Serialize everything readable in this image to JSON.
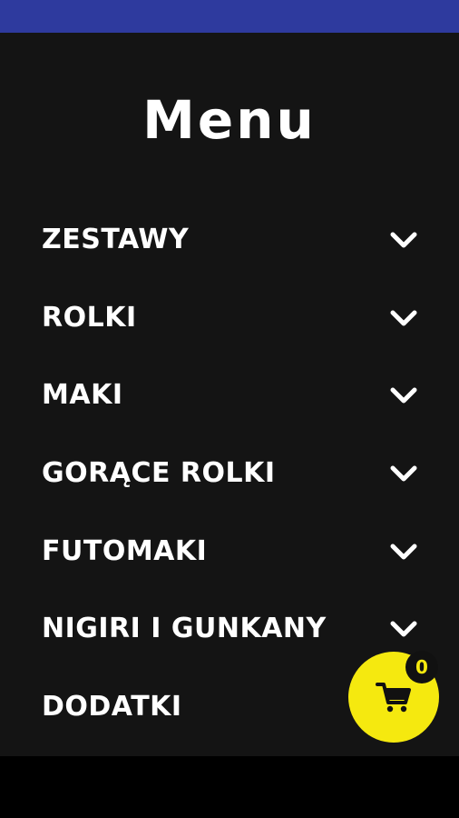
{
  "header": {
    "title": "Menu"
  },
  "menu": {
    "items": [
      {
        "label": "ZESTAWY",
        "icon": "chevron-down-icon"
      },
      {
        "label": "ROLKI",
        "icon": "chevron-down-icon"
      },
      {
        "label": "MAKI",
        "icon": "chevron-down-icon"
      },
      {
        "label": "GORĄCE ROLKI",
        "icon": "chevron-down-icon"
      },
      {
        "label": "FUTOMAKI",
        "icon": "chevron-down-icon"
      },
      {
        "label": "NIGIRI I GUNKANY",
        "icon": "chevron-down-icon"
      },
      {
        "label": "DODATKI",
        "icon": "chevron-down-icon"
      }
    ]
  },
  "cart": {
    "count": "0",
    "icon": "cart-icon"
  },
  "colors": {
    "status_bar": "#2e3a9e",
    "background": "#141414",
    "accent": "#f5e90f",
    "text": "#ffffff"
  }
}
